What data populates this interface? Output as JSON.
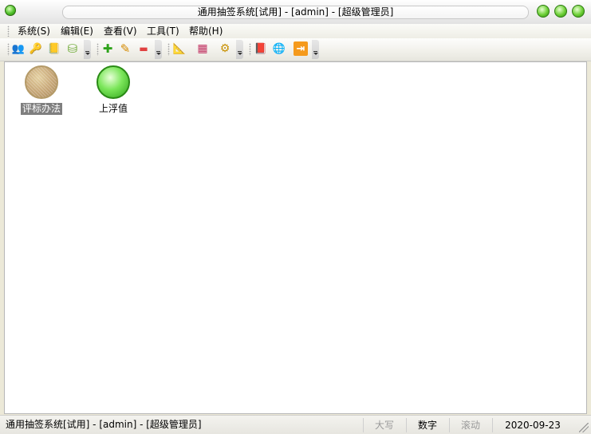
{
  "window": {
    "title": "通用抽签系统[试用]  - [admin] - [超级管理员]"
  },
  "menu": [
    {
      "label": "系统(S)"
    },
    {
      "label": "编辑(E)"
    },
    {
      "label": "查看(V)"
    },
    {
      "label": "工具(T)"
    },
    {
      "label": "帮助(H)"
    }
  ],
  "toolbar": {
    "buttons": [
      {
        "icon": "users-icon",
        "glyph": "👥"
      },
      {
        "icon": "key-icon",
        "glyph": "🔑"
      },
      {
        "icon": "notepad-icon",
        "glyph": "📒"
      },
      {
        "icon": "database-icon",
        "glyph": "⛁"
      },
      {
        "icon": "add-icon",
        "glyph": "✚"
      },
      {
        "icon": "pencil-icon",
        "glyph": "✎"
      },
      {
        "icon": "remove-icon",
        "glyph": "▬"
      },
      {
        "icon": "ruler-icon",
        "glyph": "📐"
      },
      {
        "icon": "palette-icon",
        "glyph": "▦"
      },
      {
        "icon": "gear-icon",
        "glyph": "⚙"
      },
      {
        "icon": "book-icon",
        "glyph": "📕"
      },
      {
        "icon": "globe-search-icon",
        "glyph": "🌐"
      },
      {
        "icon": "exit-icon",
        "glyph": "⇥"
      }
    ]
  },
  "desktop": {
    "items": [
      {
        "label": "评标办法",
        "selected": true
      },
      {
        "label": "上浮值",
        "selected": false
      }
    ]
  },
  "statusbar": {
    "text": "通用抽签系统[试用]  - [admin] - [超级管理员]",
    "caps": "大写",
    "num": "数字",
    "scroll": "滚动",
    "date": "2020-09-23"
  },
  "colors": {
    "accent_green": "#4fc12a",
    "selection_gray": "#7f7f7f",
    "toolbar_orange": "#f59a1c"
  }
}
